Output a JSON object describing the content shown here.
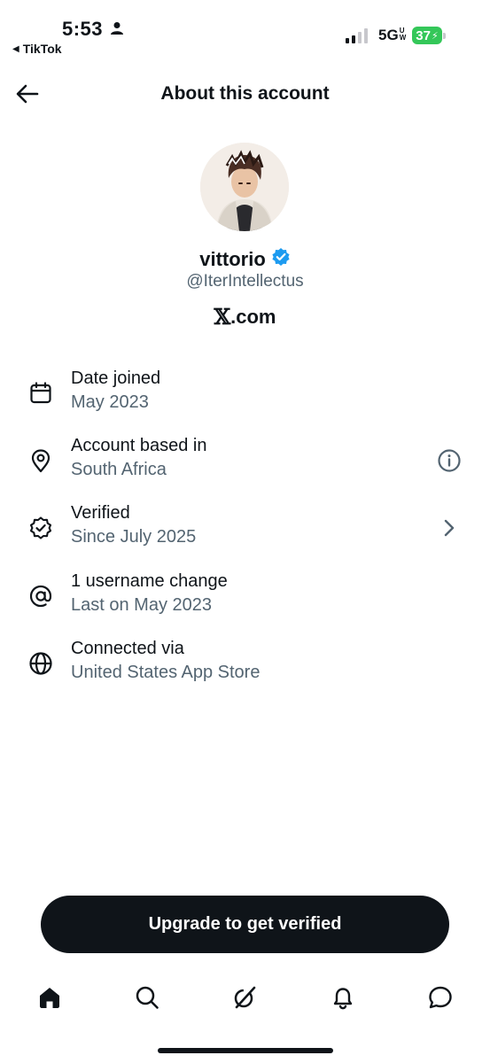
{
  "status_bar": {
    "time": "5:53",
    "back_app": "TikTok",
    "network": "5G",
    "network_sub_top": "U",
    "network_sub_bottom": "W",
    "battery": "37"
  },
  "header": {
    "title": "About this account"
  },
  "profile": {
    "name": "vittorio",
    "handle": "@IterIntellectus",
    "site_x": "𝕏",
    "site_suffix": ".com"
  },
  "info_rows": [
    {
      "icon": "calendar-icon",
      "label": "Date joined",
      "value": "May 2023"
    },
    {
      "icon": "location-pin-icon",
      "label": "Account based in",
      "value": "South Africa",
      "trailing": "info-icon"
    },
    {
      "icon": "verified-badge-outline-icon",
      "label": "Verified",
      "value": "Since July 2025",
      "trailing": "chevron-right-icon"
    },
    {
      "icon": "at-sign-icon",
      "label": "1 username change",
      "value": "Last on May 2023"
    },
    {
      "icon": "globe-icon",
      "label": "Connected via",
      "value": "United States App Store"
    }
  ],
  "cta": {
    "label": "Upgrade to get verified"
  },
  "tab_bar": [
    "home-icon",
    "search-icon",
    "grok-icon",
    "bell-icon",
    "messages-icon"
  ],
  "colors": {
    "text": "#0f1419",
    "secondary": "#536471",
    "verified_blue": "#1d9bf0",
    "battery_green": "#34c759"
  }
}
